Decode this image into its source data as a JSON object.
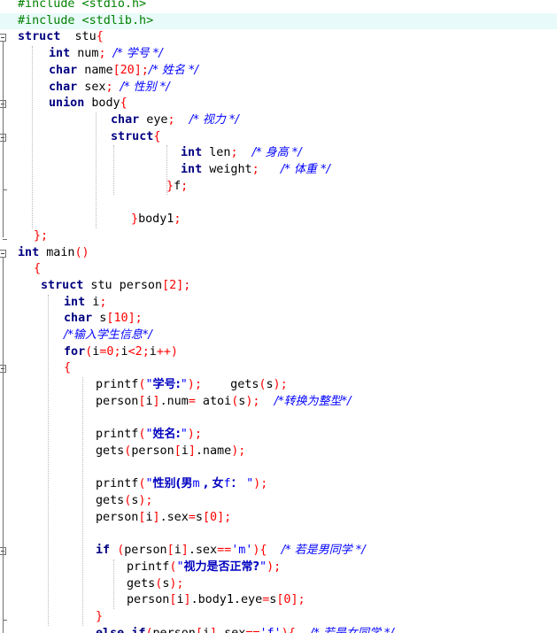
{
  "editor": {
    "lines": [
      [
        [
          "pre",
          "#include <stdio.h>"
        ]
      ],
      [
        [
          "pre",
          "#include <stdlib.h>"
        ]
      ],
      [
        [
          "kw",
          "struct"
        ],
        [
          "",
          "  stu"
        ],
        [
          "op",
          "{"
        ]
      ],
      [
        [
          "kw",
          "int"
        ],
        [
          "",
          " num"
        ],
        [
          "op",
          ";"
        ],
        [
          "",
          " "
        ],
        [
          "cm",
          "/* 学号 */"
        ]
      ],
      [
        [
          "kw",
          "char"
        ],
        [
          "",
          " name"
        ],
        [
          "op",
          "["
        ],
        [
          "num",
          "20"
        ],
        [
          "op",
          "];"
        ],
        [
          "",
          ""
        ],
        [
          "cm",
          "/* 姓名 */"
        ]
      ],
      [
        [
          "kw",
          "char"
        ],
        [
          "",
          " sex"
        ],
        [
          "op",
          ";"
        ],
        [
          "",
          " "
        ],
        [
          "cm",
          "/* 性别 */"
        ]
      ],
      [
        [
          "kw",
          "union"
        ],
        [
          "",
          " body"
        ],
        [
          "op",
          "{"
        ]
      ],
      [
        [
          "kw",
          "char"
        ],
        [
          "",
          " eye"
        ],
        [
          "op",
          ";"
        ],
        [
          "",
          "  "
        ],
        [
          "cm",
          "/* 视力 */"
        ]
      ],
      [
        [
          "kw",
          "struct"
        ],
        [
          "op",
          "{"
        ]
      ],
      [
        [
          "kw",
          "int"
        ],
        [
          "",
          " len"
        ],
        [
          "op",
          ";"
        ],
        [
          "",
          "  "
        ],
        [
          "cm",
          "/* 身高 */"
        ]
      ],
      [
        [
          "kw",
          "int"
        ],
        [
          "",
          " weight"
        ],
        [
          "op",
          ";"
        ],
        [
          "",
          "   "
        ],
        [
          "cm",
          "/* 体重 */"
        ]
      ],
      [
        [
          "op",
          "}"
        ],
        [
          "",
          "f"
        ],
        [
          "op",
          ";"
        ]
      ],
      [],
      [
        [
          "op",
          "}"
        ],
        [
          "",
          "body1"
        ],
        [
          "op",
          ";"
        ]
      ],
      [
        [
          "op",
          "};"
        ]
      ],
      [
        [
          "kw",
          "int"
        ],
        [
          "",
          " main"
        ],
        [
          "op",
          "()"
        ]
      ],
      [
        [
          "op",
          "{"
        ]
      ],
      [
        [
          "kw",
          "struct"
        ],
        [
          "",
          " stu person"
        ],
        [
          "op",
          "["
        ],
        [
          "num",
          "2"
        ],
        [
          "op",
          "];"
        ]
      ],
      [
        [
          "kw",
          "int"
        ],
        [
          "",
          " i"
        ],
        [
          "op",
          ";"
        ]
      ],
      [
        [
          "kw",
          "char"
        ],
        [
          "",
          " s"
        ],
        [
          "op",
          "["
        ],
        [
          "num",
          "10"
        ],
        [
          "op",
          "];"
        ]
      ],
      [
        [
          "cm",
          "/*输入学生信息*/"
        ]
      ],
      [
        [
          "kw",
          "for"
        ],
        [
          "op",
          "("
        ],
        [
          "",
          "i"
        ],
        [
          "op",
          "="
        ],
        [
          "num",
          "0"
        ],
        [
          "op",
          ";"
        ],
        [
          "",
          "i"
        ],
        [
          "op",
          "<"
        ],
        [
          "num",
          "2"
        ],
        [
          "op",
          ";"
        ],
        [
          "",
          "i"
        ],
        [
          "op",
          "++)"
        ]
      ],
      [
        [
          "op",
          "{"
        ]
      ],
      [
        [
          "",
          "printf"
        ],
        [
          "op",
          "("
        ],
        [
          "str",
          "\""
        ],
        [
          "cn",
          "学号:"
        ],
        [
          "str",
          "\""
        ],
        [
          "op",
          ");"
        ],
        [
          "",
          "    gets"
        ],
        [
          "op",
          "("
        ],
        [
          "",
          "s"
        ],
        [
          "op",
          ");"
        ]
      ],
      [
        [
          "",
          "person"
        ],
        [
          "op",
          "["
        ],
        [
          "",
          "i"
        ],
        [
          "op",
          "]"
        ],
        [
          "",
          ".num"
        ],
        [
          "op",
          "="
        ],
        [
          "",
          " atoi"
        ],
        [
          "op",
          "("
        ],
        [
          "",
          "s"
        ],
        [
          "op",
          ");"
        ],
        [
          "",
          "  "
        ],
        [
          "cm",
          "/*转换为整型*/"
        ]
      ],
      [],
      [
        [
          "",
          "printf"
        ],
        [
          "op",
          "("
        ],
        [
          "str",
          "\""
        ],
        [
          "cn",
          "姓名:"
        ],
        [
          "str",
          "\""
        ],
        [
          "op",
          ");"
        ]
      ],
      [
        [
          "",
          "gets"
        ],
        [
          "op",
          "("
        ],
        [
          "",
          "person"
        ],
        [
          "op",
          "["
        ],
        [
          "",
          "i"
        ],
        [
          "op",
          "]"
        ],
        [
          "",
          ".name"
        ],
        [
          "op",
          ");"
        ]
      ],
      [],
      [
        [
          "",
          "printf"
        ],
        [
          "op",
          "("
        ],
        [
          "str",
          "\""
        ],
        [
          "cn",
          "性别(男"
        ],
        [
          "str",
          "m"
        ],
        [
          "cn",
          " , 女"
        ],
        [
          "str",
          "f"
        ],
        [
          "cn",
          "： "
        ],
        [
          "str",
          "\""
        ],
        [
          "op",
          ");"
        ]
      ],
      [
        [
          "",
          "gets"
        ],
        [
          "op",
          "("
        ],
        [
          "",
          "s"
        ],
        [
          "op",
          ");"
        ]
      ],
      [
        [
          "",
          "person"
        ],
        [
          "op",
          "["
        ],
        [
          "",
          "i"
        ],
        [
          "op",
          "]"
        ],
        [
          "",
          ".sex"
        ],
        [
          "op",
          "="
        ],
        [
          "",
          "s"
        ],
        [
          "op",
          "["
        ],
        [
          "num",
          "0"
        ],
        [
          "op",
          "];"
        ]
      ],
      [],
      [
        [
          "kw",
          "if"
        ],
        [
          "",
          " "
        ],
        [
          "op",
          "("
        ],
        [
          "",
          "person"
        ],
        [
          "op",
          "["
        ],
        [
          "",
          "i"
        ],
        [
          "op",
          "]"
        ],
        [
          "",
          ".sex"
        ],
        [
          "op",
          "=="
        ],
        [
          "str",
          "'m'"
        ],
        [
          "op",
          "){"
        ],
        [
          "",
          "  "
        ],
        [
          "cm",
          "/* 若是男同学 */"
        ]
      ],
      [
        [
          "",
          "printf"
        ],
        [
          "op",
          "("
        ],
        [
          "str",
          "\""
        ],
        [
          "cn",
          "视力是否正常?"
        ],
        [
          "str",
          "\""
        ],
        [
          "op",
          ");"
        ]
      ],
      [
        [
          "",
          "gets"
        ],
        [
          "op",
          "("
        ],
        [
          "",
          "s"
        ],
        [
          "op",
          ");"
        ]
      ],
      [
        [
          "",
          "person"
        ],
        [
          "op",
          "["
        ],
        [
          "",
          "i"
        ],
        [
          "op",
          "]"
        ],
        [
          "",
          ".body1.eye"
        ],
        [
          "op",
          "="
        ],
        [
          "",
          "s"
        ],
        [
          "op",
          "["
        ],
        [
          "num",
          "0"
        ],
        [
          "op",
          "];"
        ]
      ],
      [
        [
          "op",
          "}"
        ]
      ],
      [
        [
          "kw",
          "else"
        ],
        [
          "",
          " "
        ],
        [
          "kw",
          "if"
        ],
        [
          "op",
          "("
        ],
        [
          "",
          "person"
        ],
        [
          "op",
          "["
        ],
        [
          "",
          "i"
        ],
        [
          "op",
          "]"
        ],
        [
          "",
          ".sex"
        ],
        [
          "op",
          "=="
        ],
        [
          "str",
          "'f'"
        ],
        [
          "op",
          "){"
        ],
        [
          "",
          "  "
        ],
        [
          "cm",
          "/* 若是女同学 */"
        ]
      ]
    ]
  }
}
